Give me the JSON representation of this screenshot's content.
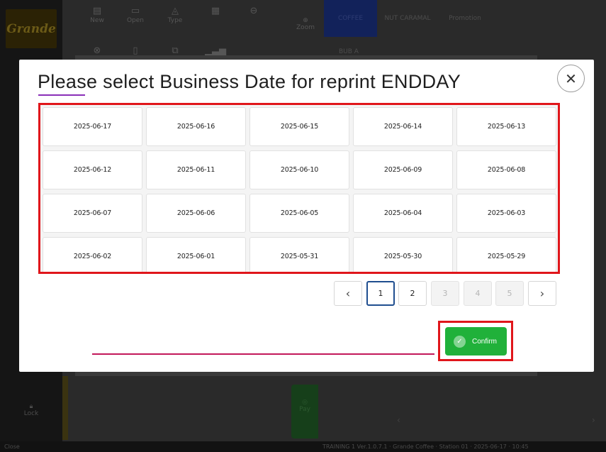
{
  "background": {
    "logo_text": "Grande",
    "toolbar": [
      {
        "label": "New",
        "icon": "new-doc-icon"
      },
      {
        "label": "Open",
        "icon": "folder-icon"
      },
      {
        "label": "Type",
        "icon": "shapes-icon"
      },
      {
        "label": "",
        "icon": "report-icon"
      },
      {
        "label": "",
        "icon": "print-icon"
      }
    ],
    "toolbar_row2_icons": [
      "cancel-icon",
      "doc-icon",
      "copy-icon",
      "chart-icon"
    ],
    "zoom_label": "Zoom",
    "categories": [
      {
        "label": "COFFEE",
        "active": true
      },
      {
        "label": "NUT CARAMAL",
        "active": false
      },
      {
        "label": "Promotion",
        "active": false
      }
    ],
    "category_sub": "BUB A",
    "lock_label": "Lock",
    "green_button_label": "Pay",
    "status_left": "Close",
    "status_right": "TRAINING  1  Ver.1.0.7.1  ·  Grande Coffee  ·  Station 01  ·  2025-06-17  ·  10:45"
  },
  "modal": {
    "title": "Please select Business Date for reprint ENDDAY",
    "close_symbol": "✕",
    "dates": [
      "2025-06-17",
      "2025-06-16",
      "2025-06-15",
      "2025-06-14",
      "2025-06-13",
      "2025-06-12",
      "2025-06-11",
      "2025-06-10",
      "2025-06-09",
      "2025-06-08",
      "2025-06-07",
      "2025-06-06",
      "2025-06-05",
      "2025-06-04",
      "2025-06-03",
      "2025-06-02",
      "2025-06-01",
      "2025-05-31",
      "2025-05-30",
      "2025-05-29"
    ],
    "pagination": {
      "prev": "‹",
      "next": "›",
      "pages": [
        "1",
        "2",
        "3",
        "4",
        "5"
      ],
      "current_page": "1",
      "enabled_pages": [
        "1",
        "2"
      ]
    },
    "input_value": "",
    "confirm_label": "Confirm",
    "confirm_icon": "check-circle-icon"
  },
  "colors": {
    "highlight": "#e0161b",
    "confirm_green": "#20b13a",
    "input_underline": "#c2185b",
    "title_underline": "#8a2fb8",
    "active_page_border": "#1f4e8f"
  }
}
